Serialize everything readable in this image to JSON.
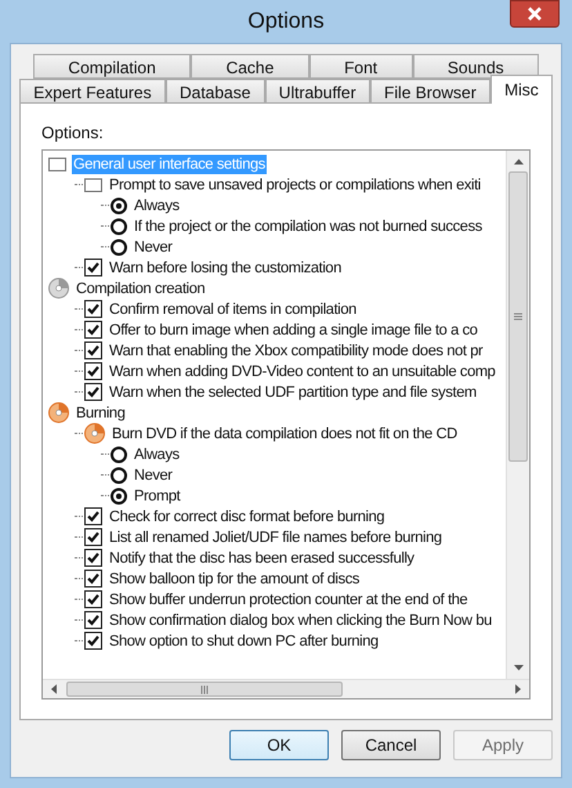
{
  "window": {
    "title": "Options"
  },
  "tabs": [
    [
      {
        "label": "Compilation",
        "selected": false
      },
      {
        "label": "Cache",
        "selected": false
      },
      {
        "label": "Font",
        "selected": false
      },
      {
        "label": "Sounds",
        "selected": false
      }
    ],
    [
      {
        "label": "Expert Features",
        "selected": false
      },
      {
        "label": "Database",
        "selected": false
      },
      {
        "label": "Ultrabuffer",
        "selected": false
      },
      {
        "label": "File Browser",
        "selected": false
      },
      {
        "label": "Misc",
        "selected": true
      }
    ]
  ],
  "options_label": "Options:",
  "tree": [
    {
      "kind": "box",
      "label": "General user interface settings",
      "selected": true,
      "children": [
        {
          "kind": "box",
          "label": "Prompt to save unsaved projects or compilations when exiti",
          "selected": false,
          "children": [
            {
              "kind": "radio",
              "label": "Always",
              "checked": true,
              "selected": false
            },
            {
              "kind": "radio",
              "label": "If the project or the compilation was not burned success",
              "checked": false,
              "selected": false
            },
            {
              "kind": "radio",
              "label": "Never",
              "checked": false,
              "selected": false
            }
          ]
        },
        {
          "kind": "checkbox",
          "label": "Warn before losing the customization",
          "checked": true,
          "selected": false
        }
      ]
    },
    {
      "kind": "disc",
      "label": "Compilation creation",
      "selected": false,
      "children": [
        {
          "kind": "checkbox",
          "label": "Confirm removal of items in compilation",
          "checked": true,
          "selected": false
        },
        {
          "kind": "checkbox",
          "label": "Offer to burn image when adding a single image file to a co",
          "checked": true,
          "selected": false
        },
        {
          "kind": "checkbox",
          "label": "Warn that enabling the Xbox compatibility mode does not pr",
          "checked": true,
          "selected": false
        },
        {
          "kind": "checkbox",
          "label": "Warn when adding DVD-Video content to an unsuitable comp",
          "checked": true,
          "selected": false
        },
        {
          "kind": "checkbox",
          "label": "Warn when the selected UDF partition type and file system",
          "checked": true,
          "selected": false
        }
      ]
    },
    {
      "kind": "burn",
      "label": "Burning",
      "selected": false,
      "children": [
        {
          "kind": "burn",
          "label": "Burn DVD if the data compilation does not fit on the CD",
          "selected": false,
          "children": [
            {
              "kind": "radio",
              "label": "Always",
              "checked": false,
              "selected": false
            },
            {
              "kind": "radio",
              "label": "Never",
              "checked": false,
              "selected": false
            },
            {
              "kind": "radio",
              "label": "Prompt",
              "checked": true,
              "selected": false
            }
          ]
        },
        {
          "kind": "checkbox",
          "label": "Check for correct disc format before burning",
          "checked": true,
          "selected": false
        },
        {
          "kind": "checkbox",
          "label": "List all renamed Joliet/UDF file names before burning",
          "checked": true,
          "selected": false
        },
        {
          "kind": "checkbox",
          "label": "Notify that the disc has been erased successfully",
          "checked": true,
          "selected": false
        },
        {
          "kind": "checkbox",
          "label": "Show balloon tip for the amount of discs",
          "checked": true,
          "selected": false
        },
        {
          "kind": "checkbox",
          "label": "Show buffer underrun protection counter at the end of the",
          "checked": true,
          "selected": false
        },
        {
          "kind": "checkbox",
          "label": "Show confirmation dialog box when clicking the Burn Now bu",
          "checked": true,
          "selected": false
        },
        {
          "kind": "checkbox",
          "label": "Show option to shut down PC after burning",
          "checked": true,
          "selected": false
        }
      ]
    }
  ],
  "buttons": [
    {
      "label": "OK",
      "kind": "default",
      "disabled": false
    },
    {
      "label": "Cancel",
      "kind": "normal",
      "disabled": false
    },
    {
      "label": "Apply",
      "kind": "normal",
      "disabled": true
    }
  ]
}
